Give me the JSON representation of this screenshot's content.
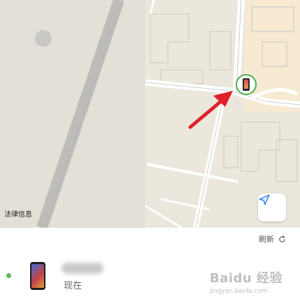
{
  "map": {
    "legal_label": "法律信息"
  },
  "toolbar": {
    "refresh_label": "刷新"
  },
  "device": {
    "status": "现在",
    "status_color": "#5cb85c"
  },
  "watermark": {
    "brand": "Baidu 经验",
    "url": "jingyan.baidu.com"
  },
  "colors": {
    "map_bg": "#ebe7dc",
    "road": "#ffffff",
    "arrow": "#e0202a",
    "pin_ring": "#4caf50",
    "locate_icon": "#2e7cf6"
  }
}
